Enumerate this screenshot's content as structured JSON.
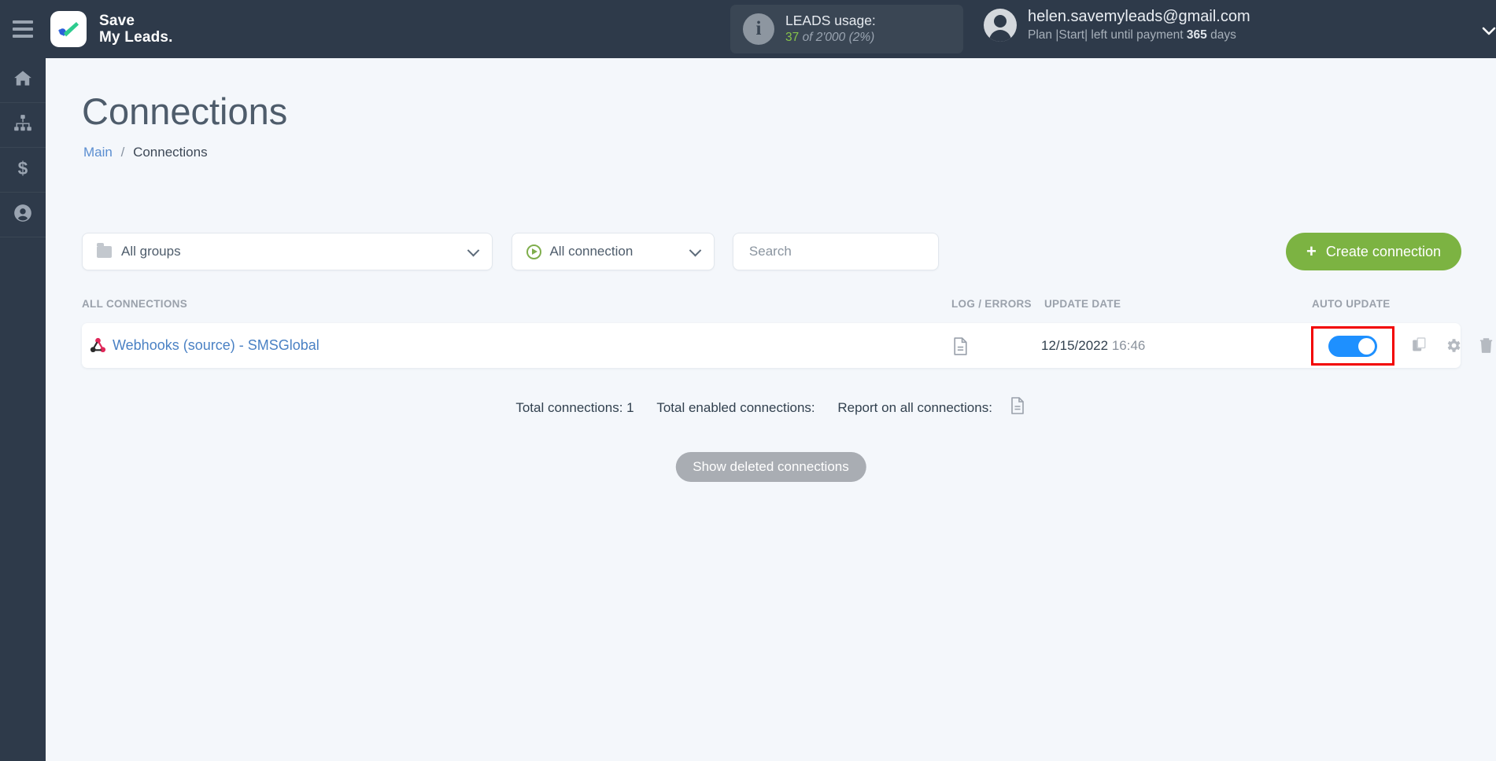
{
  "topbar": {
    "menu_icon": "hamburger-icon",
    "brand_line1": "Save",
    "brand_line2": "My Leads.",
    "leads": {
      "info_icon": "info-icon",
      "title": "LEADS usage:",
      "used": "37",
      "of_total": "of 2'000",
      "percent": "(2%)"
    },
    "user": {
      "avatar_icon": "avatar-icon",
      "email": "helen.savemyleads@gmail.com",
      "plan_prefix": "Plan |Start| left until payment ",
      "plan_days": "365",
      "plan_suffix": " days",
      "caret_icon": "chevron-down-icon"
    }
  },
  "sidebar": {
    "items": [
      {
        "name": "home",
        "icon": "home-icon"
      },
      {
        "name": "connections",
        "icon": "sitemap-icon"
      },
      {
        "name": "billing",
        "icon": "dollar-icon"
      },
      {
        "name": "account",
        "icon": "user-circle-icon"
      }
    ]
  },
  "page": {
    "title": "Connections",
    "breadcrumb": {
      "root": "Main",
      "separator": "/",
      "current": "Connections"
    }
  },
  "filters": {
    "groups": {
      "label": "All groups",
      "icon": "folder-icon",
      "caret": "chevron-down-icon"
    },
    "connection": {
      "label": "All connection",
      "icon": "play-circle-icon",
      "caret": "chevron-down-icon"
    },
    "search": {
      "value": "",
      "placeholder": "Search",
      "name": "search-input"
    },
    "create_button": {
      "label": "Create connection",
      "icon": "plus-icon"
    }
  },
  "table": {
    "headers": {
      "all_connections": "ALL CONNECTIONS",
      "log_errors": "LOG / ERRORS",
      "update_date": "UPDATE DATE",
      "auto_update": "AUTO UPDATE"
    },
    "rows": [
      {
        "icon": "webhook-icon",
        "name": "Webhooks (source) - SMSGlobal",
        "log_icon": "document-icon",
        "date": "12/15/2022",
        "time": "16:46",
        "auto_update": "on",
        "actions": [
          "copy-icon",
          "gear-icon",
          "trash-icon"
        ]
      }
    ]
  },
  "footer": {
    "total_connections": "Total connections: 1",
    "total_enabled": "Total enabled connections:",
    "report_label": "Report on all connections:",
    "report_icon": "document-icon",
    "show_deleted": "Show deleted connections"
  },
  "colors": {
    "topbar": "#2e3a4a",
    "accent_green": "#7cb342",
    "link_blue": "#4a81c4",
    "toggle_on": "#1e90ff",
    "highlight_red": "#f20000",
    "page_bg": "#f4f7fb"
  }
}
